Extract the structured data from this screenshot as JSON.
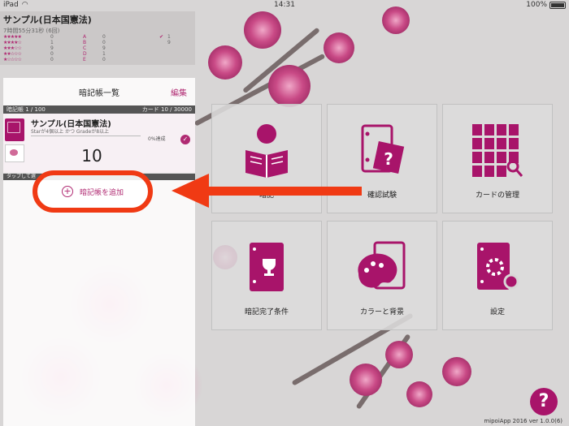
{
  "status_bar": {
    "device": "iPad",
    "time": "14:31",
    "battery": "100%"
  },
  "stats": {
    "title": "サンプル(日本国憲法)",
    "subtitle": "7時間55分31秒 (6回)",
    "rows": [
      {
        "stars": "★★★★★",
        "n1": "0",
        "grade": "A",
        "n2": "0",
        "check": "✔",
        "n3": "1"
      },
      {
        "stars": "★★★★☆",
        "n1": "1",
        "grade": "B",
        "n2": "0",
        "check": "",
        "n3": "9"
      },
      {
        "stars": "★★★☆☆",
        "n1": "9",
        "grade": "C",
        "n2": "9",
        "check": "",
        "n3": ""
      },
      {
        "stars": "★★☆☆☆",
        "n1": "0",
        "grade": "D",
        "n2": "1",
        "check": "",
        "n3": ""
      },
      {
        "stars": "★☆☆☆☆",
        "n1": "0",
        "grade": "E",
        "n2": "0",
        "check": "",
        "n3": ""
      }
    ]
  },
  "panel": {
    "title": "暗記帳一覧",
    "edit_label": "編集",
    "notebook_count": "暗記帳 1 / 100",
    "card_count": "カード 10 / 30000",
    "book": {
      "name": "サンプル(日本国憲法)",
      "condition": "Starが4個以上 かつ Gradeが8以上",
      "progress": "0%達成",
      "progress_value": 0,
      "check": "✓",
      "count": "10"
    },
    "tap_hint": "タップして選",
    "add_label": "暗記帳を追加"
  },
  "tiles": [
    {
      "label": "暗記",
      "icon": "reading-person-icon"
    },
    {
      "label": "確認試験",
      "icon": "quiz-book-icon"
    },
    {
      "label": "カードの管理",
      "icon": "card-grid-search-icon"
    },
    {
      "label": "暗記完了条件",
      "icon": "trophy-book-icon"
    },
    {
      "label": "カラーと背景",
      "icon": "palette-icon"
    },
    {
      "label": "設定",
      "icon": "settings-book-icon"
    }
  ],
  "help": "?",
  "footer": "mipoiApp 2016 ver 1.0.0(6)",
  "colors": {
    "accent": "#a8146a",
    "annotation": "#f03a14",
    "background": "#d8d6d6"
  }
}
